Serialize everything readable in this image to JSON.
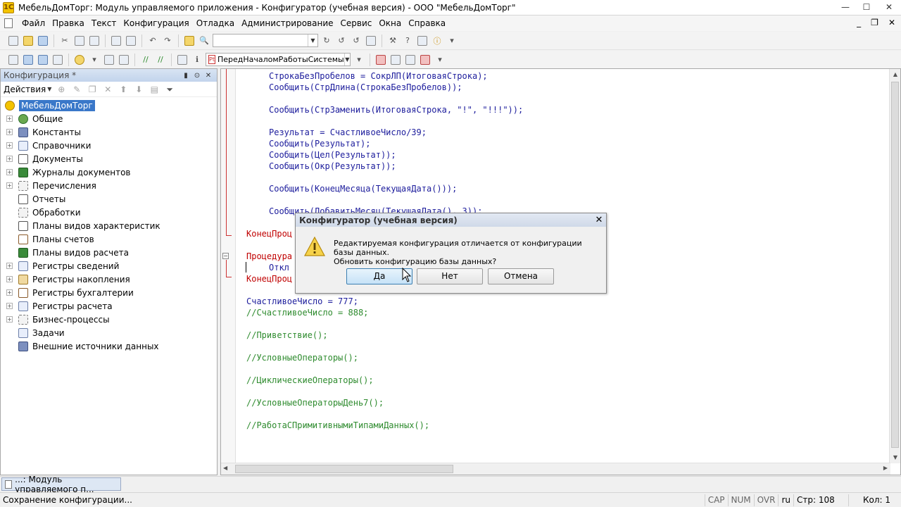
{
  "window": {
    "title": "МебельДомТорг: Модуль управляемого приложения - Конфигуратор (учебная версия) - ООО \"МебельДомТорг\"",
    "minimize": "—",
    "maximize": "☐",
    "close": "✕"
  },
  "menu": {
    "items": [
      "Файл",
      "Правка",
      "Текст",
      "Конфигурация",
      "Отладка",
      "Администрирование",
      "Сервис",
      "Окна",
      "Справка"
    ],
    "mdi_minimize": "_",
    "mdi_restore": "❐",
    "mdi_close": "✕"
  },
  "toolbar2": {
    "procedure_select": "ПередНачаломРаботыСистемы",
    "procedure_icon": "Pt"
  },
  "config_panel": {
    "title": "Конфигурация *",
    "actions_label": "Действия",
    "root": "МебельДомТорг",
    "nodes": [
      {
        "label": "Общие",
        "expandable": true
      },
      {
        "label": "Константы",
        "expandable": true
      },
      {
        "label": "Справочники",
        "expandable": true
      },
      {
        "label": "Документы",
        "expandable": true
      },
      {
        "label": "Журналы документов",
        "expandable": true
      },
      {
        "label": "Перечисления",
        "expandable": true
      },
      {
        "label": "Отчеты",
        "expandable": false
      },
      {
        "label": "Обработки",
        "expandable": false
      },
      {
        "label": "Планы видов характеристик",
        "expandable": false
      },
      {
        "label": "Планы счетов",
        "expandable": false
      },
      {
        "label": "Планы видов расчета",
        "expandable": false
      },
      {
        "label": "Регистры сведений",
        "expandable": true
      },
      {
        "label": "Регистры накопления",
        "expandable": true
      },
      {
        "label": "Регистры бухгалтерии",
        "expandable": true
      },
      {
        "label": "Регистры расчета",
        "expandable": true
      },
      {
        "label": "Бизнес-процессы",
        "expandable": true
      },
      {
        "label": "Задачи",
        "expandable": false
      },
      {
        "label": "Внешние источники данных",
        "expandable": false
      }
    ]
  },
  "code_lines": {
    "l1": "СтрокаБезПробелов = СокрЛП(ИтоговаяСтрока);",
    "l2": "Сообщить(СтрДлина(СтрокаБезПробелов));",
    "l3": "Сообщить(СтрЗаменить(ИтоговаяСтрока, \"!\", \"!!!\"));",
    "l4": "Результат = СчастливоеЧисло/39;",
    "l5": "Сообщить(Результат);",
    "l6": "Сообщить(Цел(Результат));",
    "l7": "Сообщить(Окр(Результат));",
    "l8": "Сообщить(КонецМесяца(ТекущаяДата()));",
    "l9": "Сообщить(ДобавитьМесяц(ТекущаяДата(), 3));",
    "l10": "КонецПроц",
    "l11": "Процедура",
    "l12": "Откл",
    "l13": "КонецПроц",
    "l14": "СчастливоеЧисло = 777;",
    "l15": "//СчастливоеЧисло = 888;",
    "l16": "//Приветствие();",
    "l17": "//УсловныеОператоры();",
    "l18": "//ЦиклическиеОператоры();",
    "l19": "//УсловныеОператорыДень7();",
    "l20": "//РаботаСПримитивнымиТипамиДанных();"
  },
  "dialog": {
    "title": "Конфигуратор (учебная версия)",
    "close": "✕",
    "message_line1": "Редактируемая конфигурация отличается от конфигурации базы данных.",
    "message_line2": "Обновить конфигурацию базы данных?",
    "btn_yes": "Да",
    "btn_no": "Нет",
    "btn_cancel": "Отмена"
  },
  "taskbar": {
    "item": "...: Модуль управляемого п..."
  },
  "status": {
    "text": "Сохранение конфигурации...",
    "cap": "CAP",
    "num": "NUM",
    "ovr": "OVR",
    "lang": "ru",
    "line": "Стр: 108",
    "col": "Кол: 1"
  },
  "colors": {
    "keyword": "#c00000",
    "identifier": "#1c1c9c",
    "comment": "#2e8b2e",
    "selection": "#3a78c9"
  }
}
